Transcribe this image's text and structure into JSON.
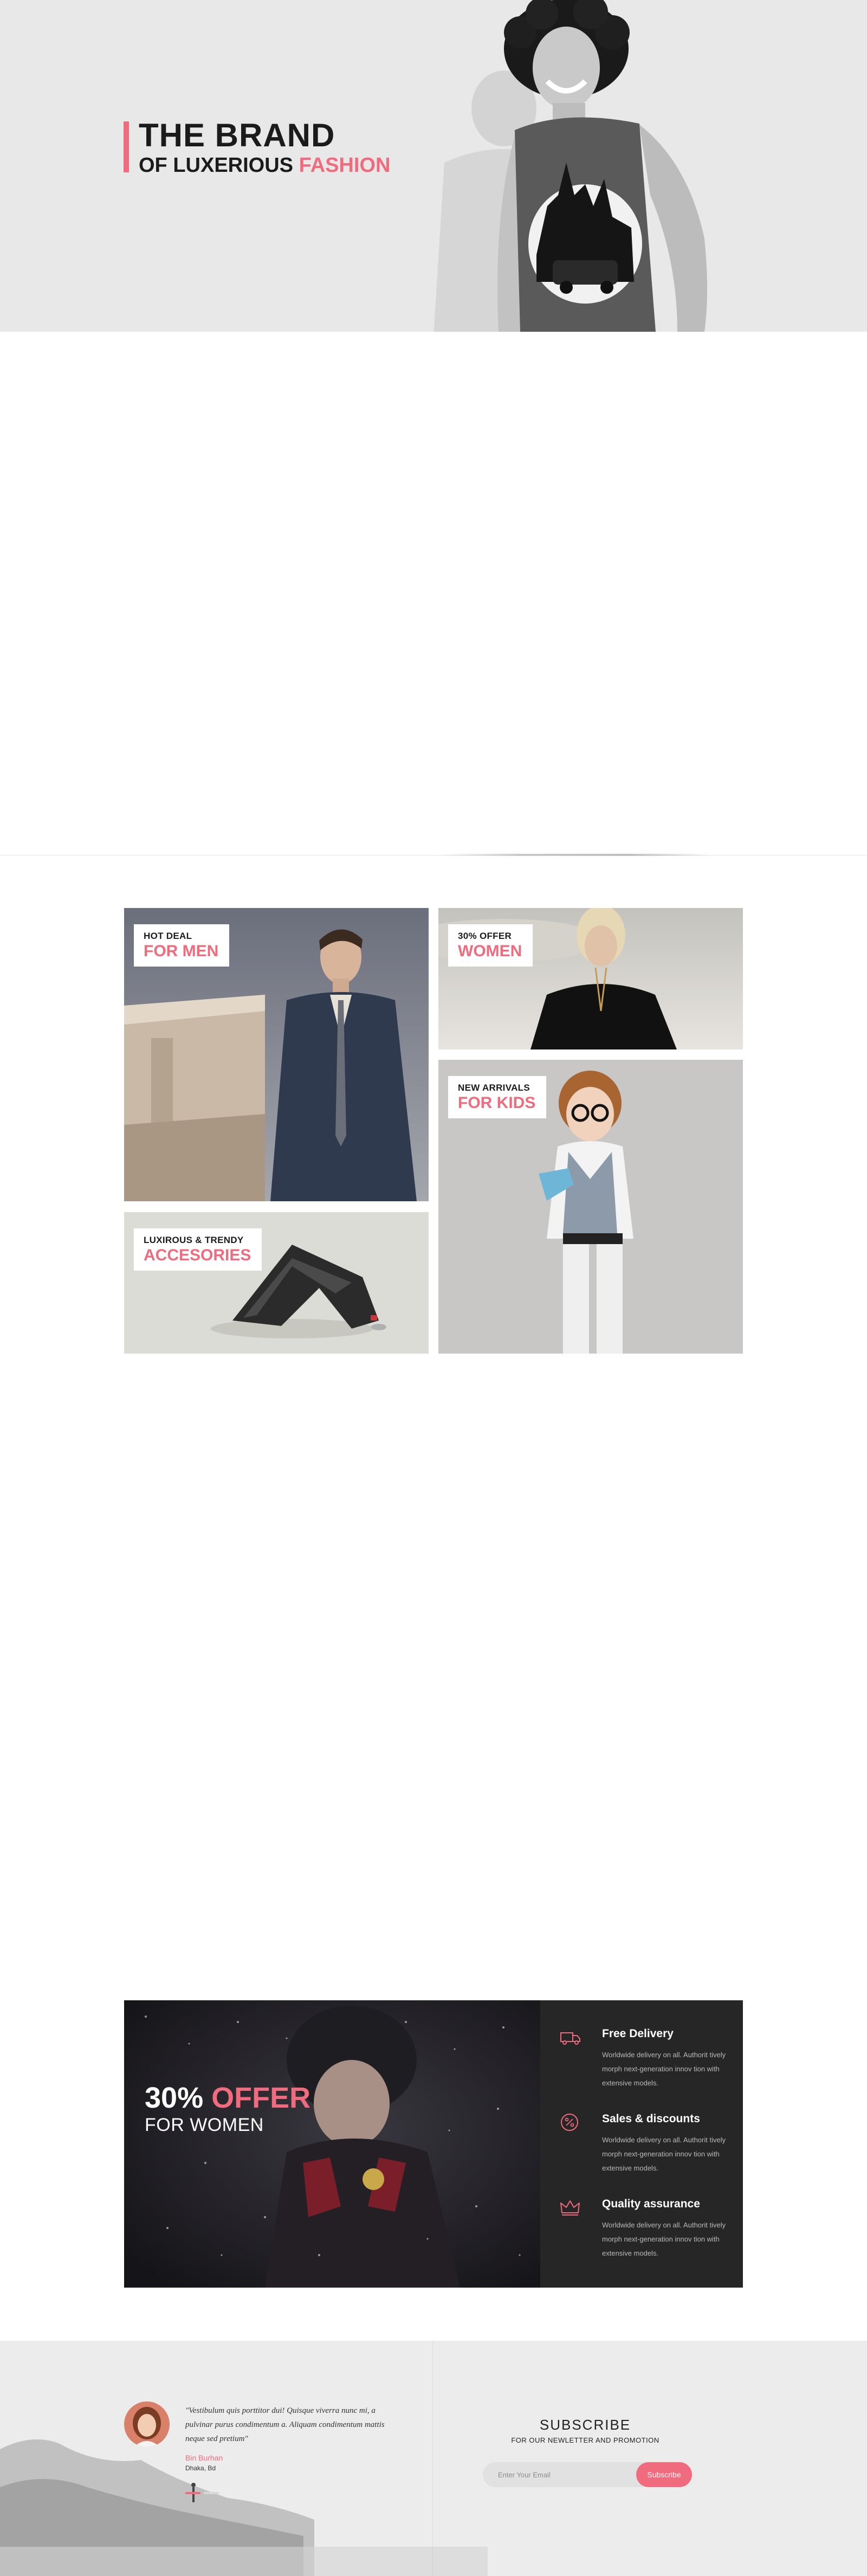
{
  "hero": {
    "title_line1": "THE BRAND",
    "title_line2_prefix": "OF LUXERIOUS ",
    "title_line2_accent": "FASHION"
  },
  "categories": {
    "men": {
      "small": "HOT DEAL",
      "big": "FOR MEN"
    },
    "women": {
      "small": "30% OFFER",
      "big": "WOMEN"
    },
    "kids": {
      "small": "NEW ARRIVALS",
      "big": "FOR KIDS"
    },
    "accessories": {
      "small": "LUXIROUS & TRENDY",
      "big": "ACCESORIES"
    }
  },
  "offer": {
    "percent": "30%",
    "accent": "OFFER",
    "subtitle": "FOR WOMEN",
    "features": [
      {
        "icon": "truck-icon",
        "title": "Free Delivery",
        "desc": "Worldwide delivery on all. Authorit tively morph next-generation innov tion with extensive models."
      },
      {
        "icon": "percent-badge-icon",
        "title": "Sales & discounts",
        "desc": "Worldwide delivery on all. Authorit tively morph next-generation innov tion with extensive models."
      },
      {
        "icon": "crown-icon",
        "title": "Quality assurance",
        "desc": "Worldwide delivery on all. Authorit tively morph next-generation innov tion with extensive models."
      }
    ]
  },
  "testimonial": {
    "quote": "\"Vestibulum quis porttitor dui! Quisque viverra nunc mi, a pulvinar purus condimentum a. Aliquam condimentum mattis neque sed pretium\"",
    "name": "Bin Burhan",
    "location": "Dhaka, Bd"
  },
  "newsletter": {
    "title": "SUBSCRIBE",
    "subtitle": "FOR OUR NEWLETTER AND PROMOTION",
    "placeholder": "Enter Your Email",
    "button": "Subscribe"
  },
  "colors": {
    "accent": "#f06b7d",
    "dark_panel": "#242424",
    "hero_bg": "#e8e8e8"
  }
}
